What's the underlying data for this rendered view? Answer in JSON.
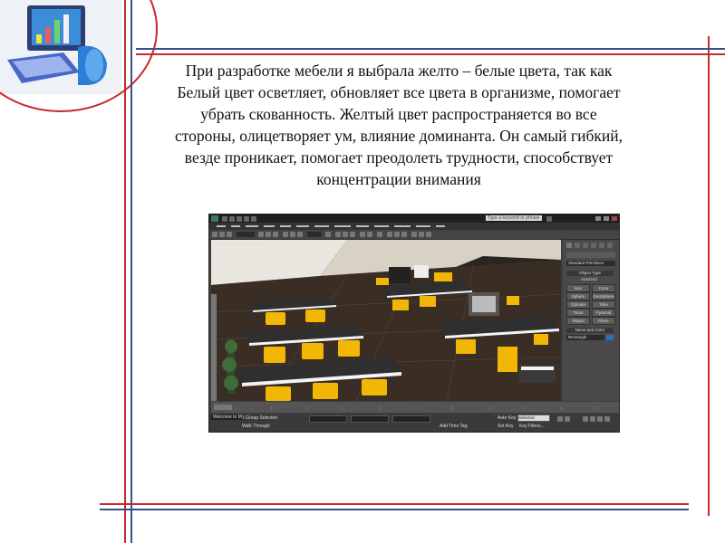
{
  "slide": {
    "paragraph_lines": [
      "При разработке мебели я выбрала желто – белые цвета, так как",
      "Белый цвет осветляет, обновляет все цвета в организме, помогает",
      "убрать скованность. Желтый цвет распространяется во все",
      "стороны, олицетворяет ум, влияние доминанта. Он самый гибкий,",
      "везде проникает, помогает преодолеть трудности, способствует",
      "концентрации внимания"
    ]
  },
  "colors": {
    "frame_red": "#c62b2b",
    "frame_blue": "#3a4f8c",
    "chair_yellow": "#f2b705",
    "desk_dark": "#3a3a3a",
    "desk_white": "#f4f4f4"
  },
  "app": {
    "search_placeholder": "Type a keyword or phrase",
    "viewport_label": "[+][Perspective][Realistic]",
    "command_panel": {
      "dropdown": "Standard Primitives",
      "section_object_type": "Object Type",
      "autogrid": "AutoGrid",
      "buttons": [
        "Box",
        "Cone",
        "Sphere",
        "GeoSphere",
        "Cylinder",
        "Tube",
        "Torus",
        "Pyramid",
        "Teapot",
        "Plane"
      ],
      "section_name_color": "Name and Color",
      "object_name": "Rectangle"
    },
    "status": {
      "selection": "1 Group Selected",
      "prompt": "Walk Through",
      "add_time_tag": "Add Time Tag",
      "auto_key": "Auto Key",
      "selected": "Selected",
      "set_key": "Set Key",
      "key_filters": "Key Filters...",
      "welcome": "Welcome to M"
    }
  }
}
